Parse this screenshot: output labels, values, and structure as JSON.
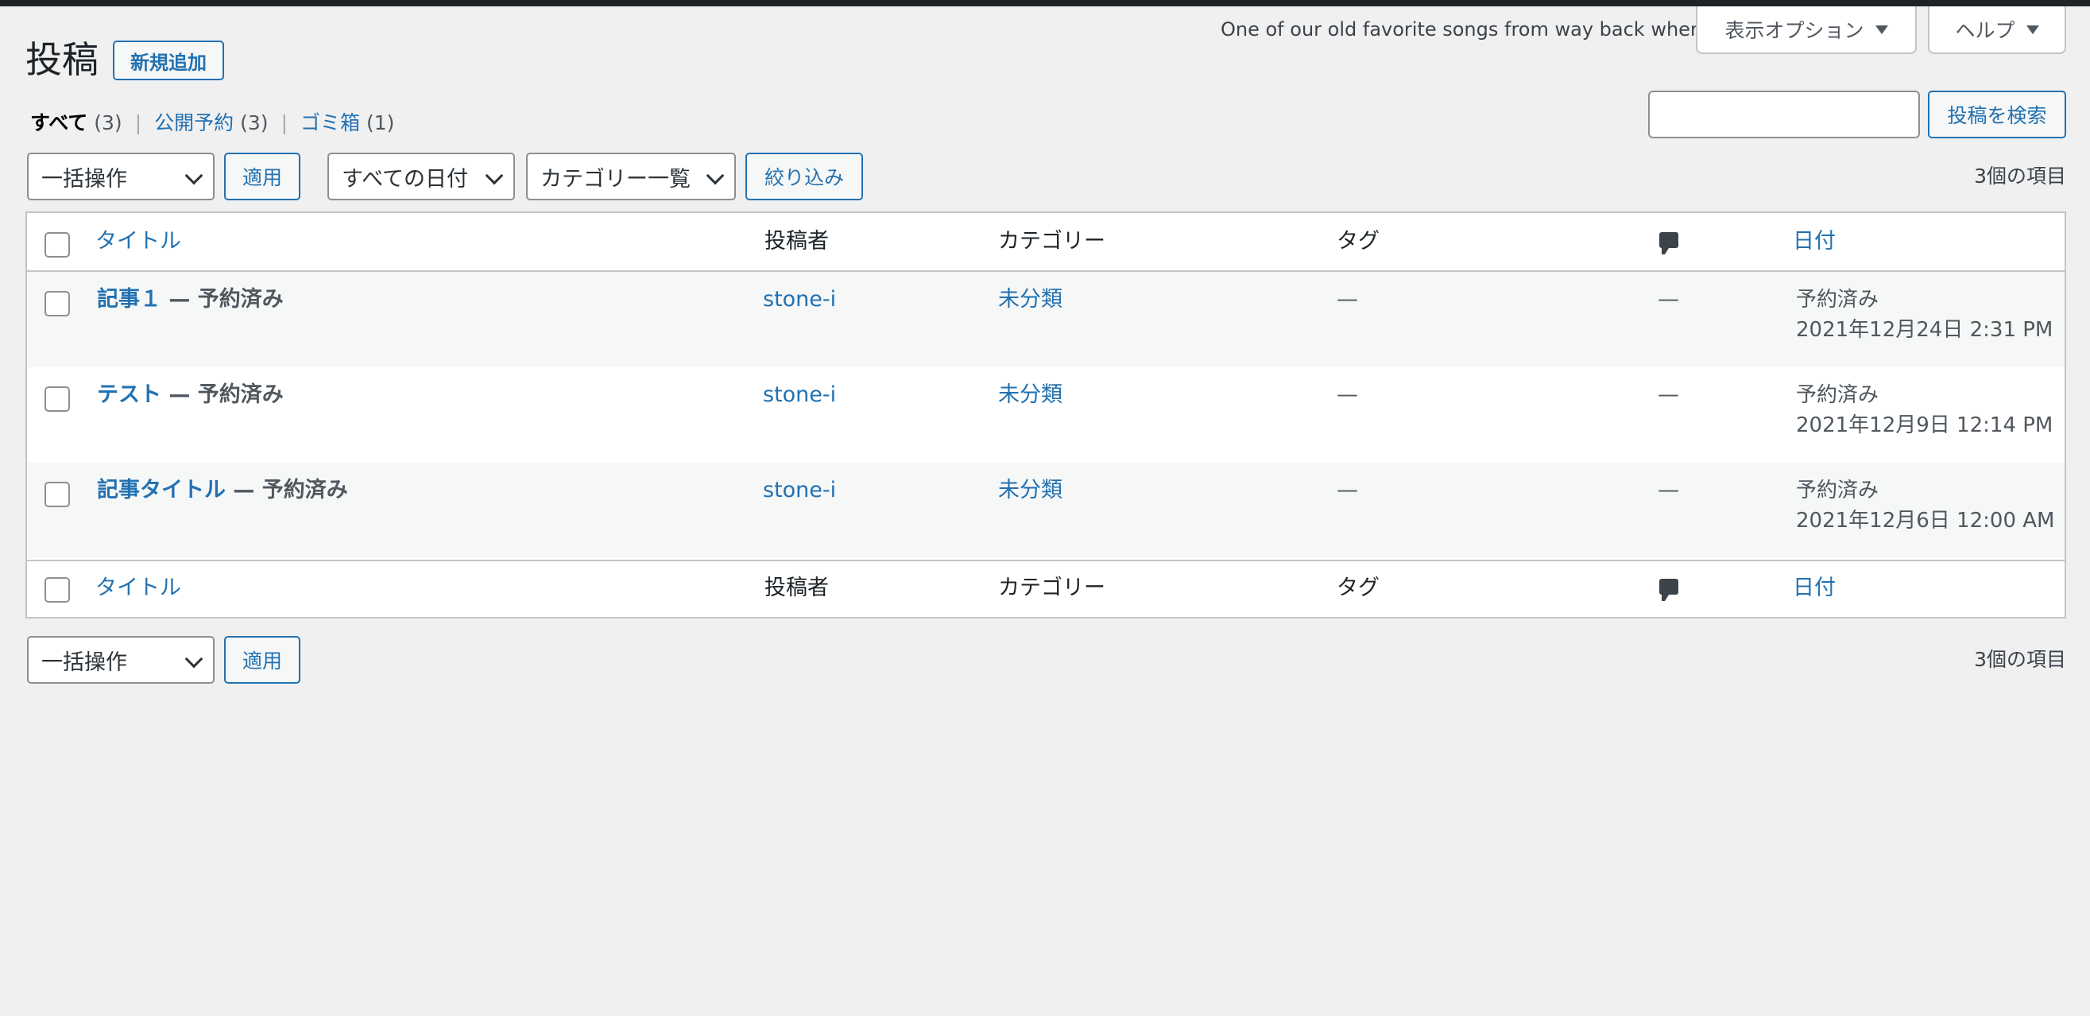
{
  "screen_options": {
    "hello_lyric": "One of our old favorite songs from way back when",
    "display_options_label": "表示オプション",
    "help_label": "ヘルプ"
  },
  "header": {
    "page_title": "投稿",
    "add_new_label": "新規追加"
  },
  "views": [
    {
      "label": "すべて",
      "count": "(3)",
      "current": true
    },
    {
      "label": "公開予約",
      "count": "(3)",
      "current": false
    },
    {
      "label": "ゴミ箱",
      "count": "(1)",
      "current": false
    }
  ],
  "views_separator": "|",
  "search": {
    "value": "",
    "button_label": "投稿を検索"
  },
  "tablenav_top": {
    "bulk_action": "一括操作",
    "apply_label": "適用",
    "date_filter": "すべての日付",
    "category_filter": "カテゴリー一覧",
    "filter_label": "絞り込み",
    "item_count": "3個の項目"
  },
  "columns": {
    "title": "タイトル",
    "author": "投稿者",
    "categories": "カテゴリー",
    "tags": "タグ",
    "date": "日付"
  },
  "rows": [
    {
      "title": "記事１",
      "state": "— 予約済み",
      "author": "stone-i",
      "category": "未分類",
      "tags": "—",
      "comments": "—",
      "date_status": "予約済み",
      "date": "2021年12月24日 2:31 PM"
    },
    {
      "title": "テスト",
      "state": "— 予約済み",
      "author": "stone-i",
      "category": "未分類",
      "tags": "—",
      "comments": "—",
      "date_status": "予約済み",
      "date": "2021年12月9日 12:14 PM"
    },
    {
      "title": "記事タイトル",
      "state": "— 予約済み",
      "author": "stone-i",
      "category": "未分類",
      "tags": "—",
      "comments": "—",
      "date_status": "予約済み",
      "date": "2021年12月6日 12:00 AM"
    }
  ],
  "tablenav_bottom": {
    "bulk_action": "一括操作",
    "apply_label": "適用",
    "item_count": "3個の項目"
  },
  "icons": {
    "comments": "comment-bubble-icon",
    "dropdown": "chevron-down-icon",
    "toggle": "triangle-down-icon"
  },
  "colors": {
    "accent": "#2271b1",
    "admin_bar": "#1d2327",
    "background": "#f0f0f1"
  }
}
